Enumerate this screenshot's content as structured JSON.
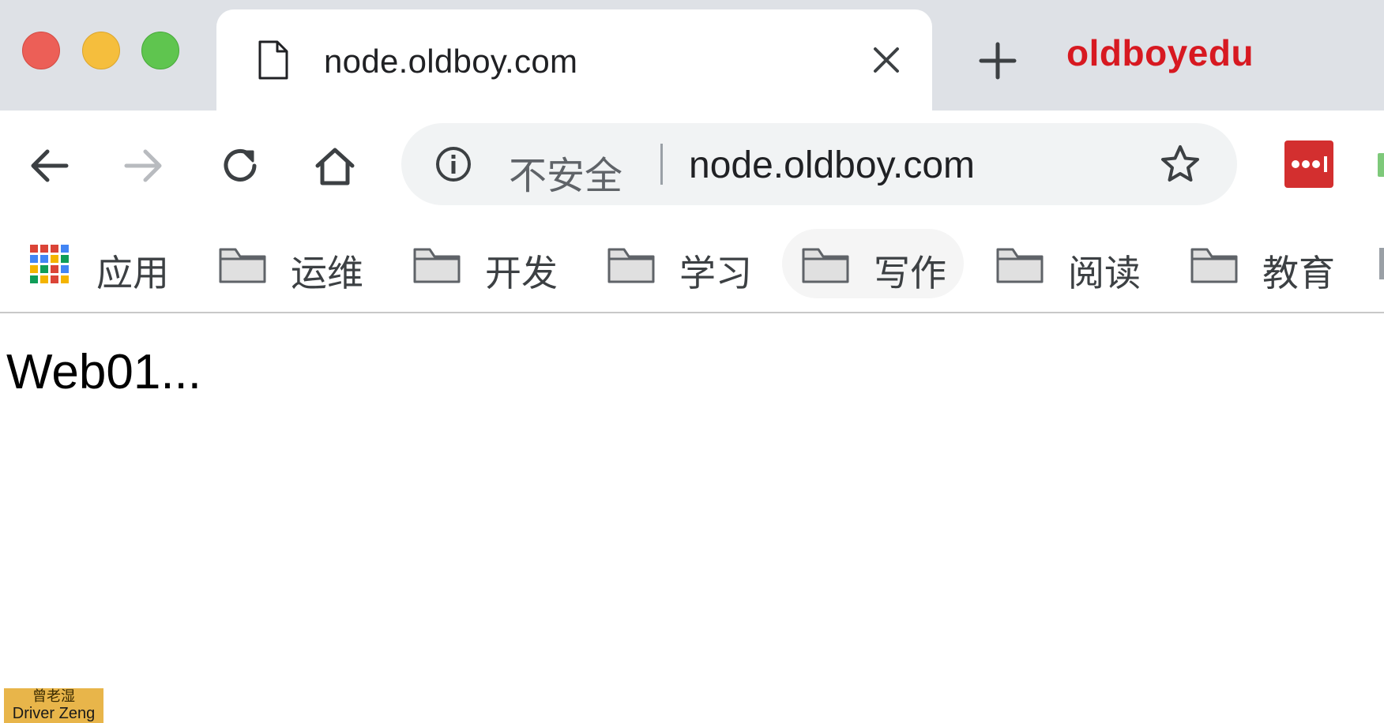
{
  "window": {
    "controls": [
      "close",
      "minimize",
      "zoom"
    ],
    "colors": {
      "close": "#ec5f57",
      "minimize": "#f5be3d",
      "zoom": "#5fc54f"
    }
  },
  "tab": {
    "icon": "page-icon",
    "title": "node.oldboy.com",
    "close_icon": "close-icon"
  },
  "new_tab_icon": "plus-icon",
  "brand": {
    "text": "oldboyedu",
    "color": "#d71921"
  },
  "toolbar": {
    "back_icon": "arrow-left-icon",
    "forward_icon": "arrow-right-icon",
    "reload_icon": "reload-icon",
    "home_icon": "home-icon",
    "omnibox": {
      "security_icon": "info-icon",
      "security_label": "不安全",
      "url": "node.oldboy.com",
      "bookmark_icon": "star-icon"
    },
    "extension": {
      "icon": "lastpass-icon",
      "color": "#d32f2f"
    }
  },
  "bookmarks": [
    {
      "label": "应用",
      "icon": "apps-grid-icon"
    },
    {
      "label": "运维",
      "icon": "folder-icon"
    },
    {
      "label": "开发",
      "icon": "folder-icon"
    },
    {
      "label": "学习",
      "icon": "folder-icon"
    },
    {
      "label": "写作",
      "icon": "folder-icon",
      "highlighted": true
    },
    {
      "label": "阅读",
      "icon": "folder-icon"
    },
    {
      "label": "教育",
      "icon": "folder-icon"
    }
  ],
  "page": {
    "text": "Web01..."
  },
  "watermark": {
    "line1": "曾老湿",
    "line2": "Driver Zeng",
    "color": "#e8b54a"
  }
}
